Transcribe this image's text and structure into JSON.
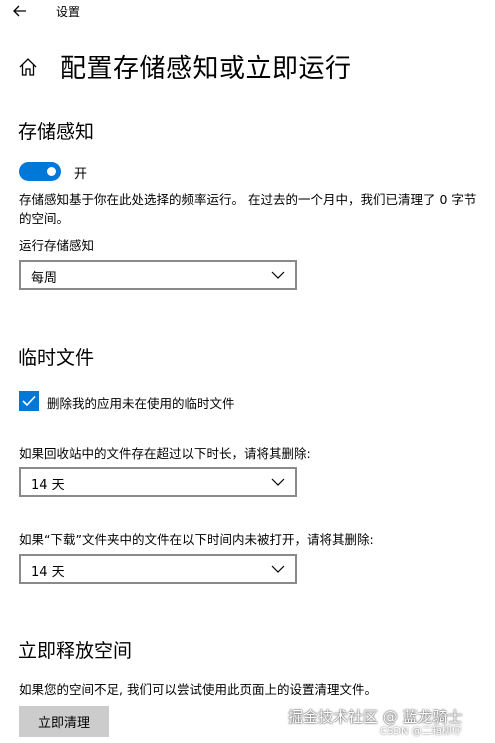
{
  "header": {
    "app_title": "设置",
    "page_title": "配置存储感知或立即运行"
  },
  "storage_sense": {
    "title": "存储感知",
    "toggle_label": "开",
    "toggle_on": true,
    "description": "存储感知基于你在此处选择的频率运行。 在过去的一个月中，我们已清理了 0 字节 的空间。",
    "run_label": "运行存储感知",
    "run_value": "每周"
  },
  "temp_files": {
    "title": "临时文件",
    "checkbox_label": "删除我的应用未在使用的临时文件",
    "checkbox_checked": true,
    "recycle_label": "如果回收站中的文件存在超过以下时长，请将其删除:",
    "recycle_value": "14 天",
    "downloads_label": "如果“下载”文件夹中的文件在以下时间内未被打开，请将其删除:",
    "downloads_value": "14 天"
  },
  "free_space": {
    "title": "立即释放空间",
    "description": "如果您的空间不足, 我们可以尝试使用此页面上的设置清理文件。",
    "button_label": "立即清理"
  },
  "watermark": {
    "main": "掘金技术社区 @ 蓝龙骑士",
    "sub": "CSDN @二箱柳仔"
  },
  "colors": {
    "accent": "#0078d7",
    "border": "#8a8a8a",
    "button_bg": "#cccccc"
  },
  "icons": {
    "back": "back-arrow-icon",
    "home": "home-icon",
    "chevron": "chevron-down-icon",
    "check": "checkmark-icon"
  }
}
